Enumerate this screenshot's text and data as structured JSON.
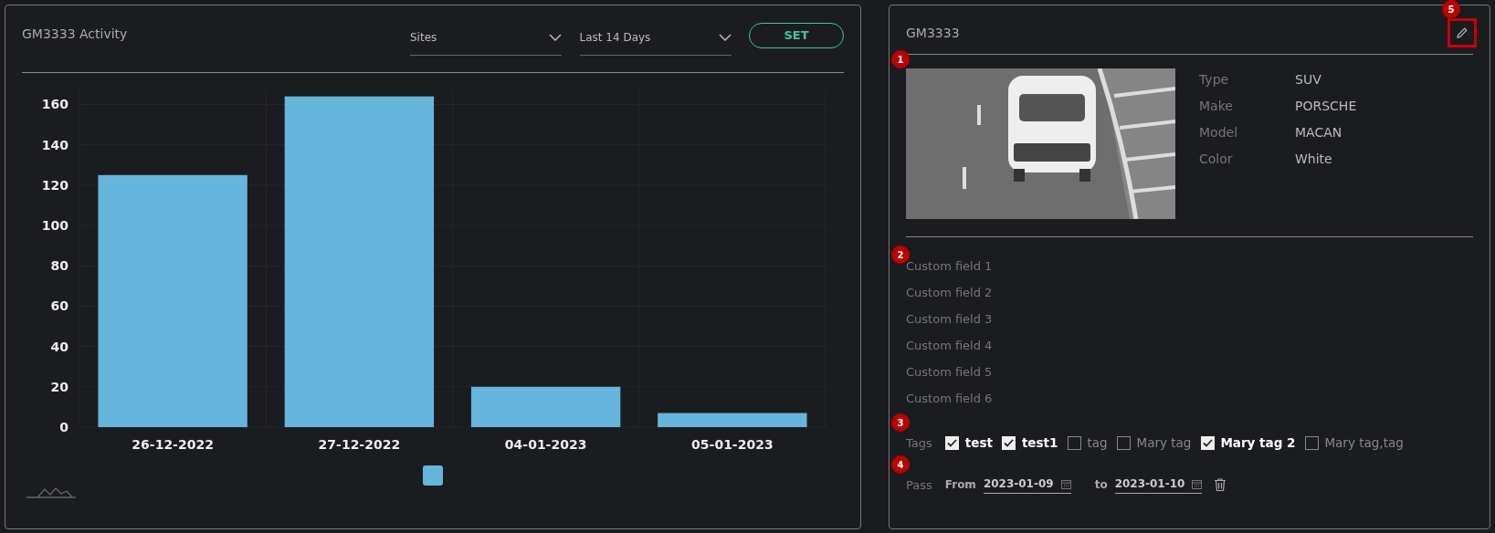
{
  "activity_panel": {
    "title": "GM3333 Activity",
    "selects": [
      {
        "value": "Sites"
      },
      {
        "value": "Last 14 Days"
      }
    ],
    "set_button": "SET",
    "chart_data": {
      "type": "bar",
      "categories": [
        "26-12-2022",
        "27-12-2022",
        "04-01-2023",
        "05-01-2023"
      ],
      "series": [
        {
          "color": "#66b5dc",
          "values": [
            125,
            164,
            20,
            7
          ]
        }
      ],
      "ylim": [
        0,
        167
      ],
      "grid": true,
      "yticks": [
        0,
        20,
        40,
        60,
        80,
        100,
        120,
        140,
        160
      ]
    }
  },
  "vehicle_panel": {
    "title": "GM3333",
    "details": [
      {
        "label": "Type",
        "value": "SUV"
      },
      {
        "label": "Make",
        "value": "PORSCHE"
      },
      {
        "label": "Model",
        "value": "MACAN"
      },
      {
        "label": "Color",
        "value": "White"
      }
    ],
    "custom_fields": [
      "Custom field 1",
      "Custom field 2",
      "Custom field 3",
      "Custom field 4",
      "Custom field 5",
      "Custom field 6"
    ],
    "tags_label": "Tags",
    "tags": [
      {
        "label": "test",
        "checked": true
      },
      {
        "label": "test1",
        "checked": true
      },
      {
        "label": "tag",
        "checked": false
      },
      {
        "label": "Mary tag",
        "checked": false
      },
      {
        "label": "Mary tag 2",
        "checked": true
      },
      {
        "label": "Mary tag,tag",
        "checked": false
      }
    ],
    "pass": {
      "label": "Pass",
      "from_label": "From",
      "from": "2023-01-09",
      "to_label": "to",
      "to": "2023-01-10"
    }
  },
  "markers": [
    "1",
    "2",
    "3",
    "4",
    "5"
  ]
}
